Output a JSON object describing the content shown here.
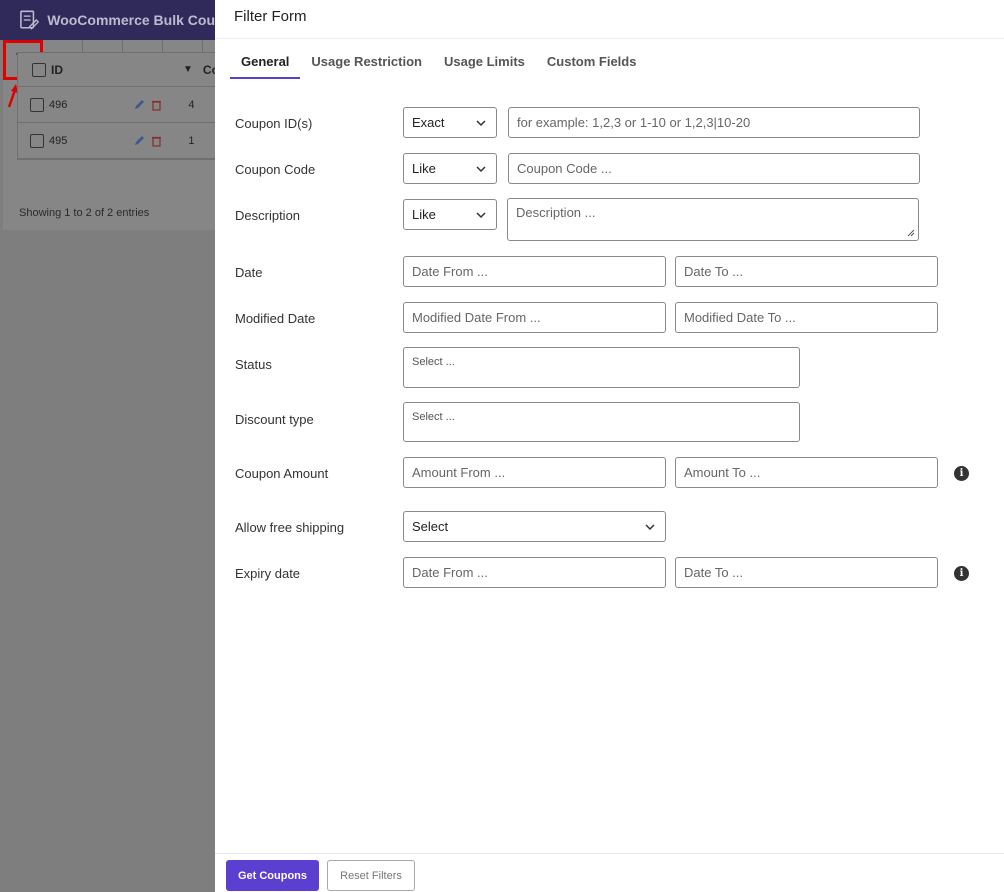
{
  "background": {
    "app_title": "WooCommerce Bulk Cou",
    "table": {
      "header_id": "ID",
      "header_code": "Co",
      "rows": [
        {
          "id": "496",
          "code": "4"
        },
        {
          "id": "495",
          "code": "1"
        }
      ]
    },
    "showing": "Showing 1 to 2 of 2 entries"
  },
  "panel": {
    "title": "Filter Form",
    "tabs": [
      "General",
      "Usage Restriction",
      "Usage Limits",
      "Custom Fields"
    ],
    "fields": {
      "coupon_ids": {
        "label": "Coupon ID(s)",
        "operator": "Exact",
        "placeholder": "for example: 1,2,3 or 1-10 or 1,2,3|10-20"
      },
      "coupon_code": {
        "label": "Coupon Code",
        "operator": "Like",
        "placeholder": "Coupon Code ..."
      },
      "description": {
        "label": "Description",
        "operator": "Like",
        "placeholder": "Description ..."
      },
      "date": {
        "label": "Date",
        "from_placeholder": "Date From ...",
        "to_placeholder": "Date To ..."
      },
      "modified_date": {
        "label": "Modified Date",
        "from_placeholder": "Modified Date From ...",
        "to_placeholder": "Modified Date To ..."
      },
      "status": {
        "label": "Status",
        "placeholder": "Select ..."
      },
      "discount_type": {
        "label": "Discount type",
        "placeholder": "Select ..."
      },
      "coupon_amount": {
        "label": "Coupon Amount",
        "from_placeholder": "Amount From ...",
        "to_placeholder": "Amount To ..."
      },
      "free_shipping": {
        "label": "Allow free shipping",
        "value": "Select"
      },
      "expiry_date": {
        "label": "Expiry date",
        "from_placeholder": "Date From ...",
        "to_placeholder": "Date To ..."
      }
    },
    "info_glyph": "i",
    "buttons": {
      "get": "Get Coupons",
      "reset": "Reset Filters"
    }
  },
  "colors": {
    "accent": "#5b3fd0",
    "highlight": "#e00000"
  }
}
